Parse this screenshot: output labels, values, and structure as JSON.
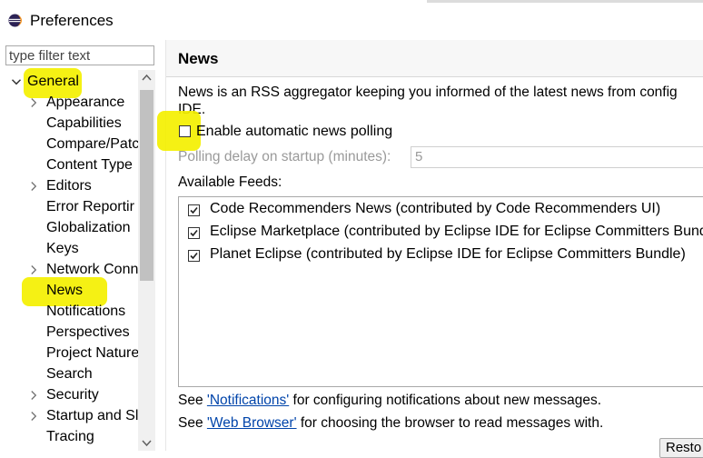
{
  "window": {
    "title": "Preferences",
    "icon": "eclipse-icon"
  },
  "sidebar": {
    "filter_placeholder": "type filter text",
    "tree": [
      {
        "label": "General",
        "expanded": true,
        "level": 0
      },
      {
        "label": "Appearance",
        "expandable": true,
        "level": 1
      },
      {
        "label": "Capabilities",
        "level": 1
      },
      {
        "label": "Compare/Patc",
        "level": 1
      },
      {
        "label": "Content Type",
        "level": 1
      },
      {
        "label": "Editors",
        "expandable": true,
        "level": 1
      },
      {
        "label": "Error Reportir",
        "level": 1
      },
      {
        "label": "Globalization",
        "level": 1
      },
      {
        "label": "Keys",
        "level": 1
      },
      {
        "label": "Network Conn",
        "expandable": true,
        "level": 1
      },
      {
        "label": "News",
        "selected": true,
        "level": 1
      },
      {
        "label": "Notifications",
        "level": 1
      },
      {
        "label": "Perspectives",
        "level": 1
      },
      {
        "label": "Project Nature",
        "level": 1
      },
      {
        "label": "Search",
        "level": 1
      },
      {
        "label": "Security",
        "expandable": true,
        "level": 1
      },
      {
        "label": "Startup and Sl",
        "expandable": true,
        "level": 1
      },
      {
        "label": "Tracing",
        "level": 1
      }
    ]
  },
  "page": {
    "title": "News",
    "description": "News is an RSS aggregator keeping you informed of the latest news from configured feeds in the Eclipse IDE.",
    "description_line1": "News is an RSS aggregator keeping you informed of the latest news from config",
    "description_line2": "IDE.",
    "enable_polling": {
      "label": "Enable automatic news polling",
      "checked": false
    },
    "polling_delay": {
      "label": "Polling delay on startup (minutes):",
      "value": "5",
      "disabled": true
    },
    "feeds_label": "Available Feeds:",
    "feeds": [
      {
        "label": "Code Recommenders News (contributed by Code Recommenders UI)",
        "checked": true
      },
      {
        "label": "Eclipse Marketplace (contributed by Eclipse IDE for Eclipse Committers Bundle)",
        "checked": true
      },
      {
        "label": "Planet Eclipse (contributed by Eclipse IDE for Eclipse Committers Bundle)",
        "checked": true
      }
    ],
    "footer": [
      {
        "prefix": "See ",
        "link": "'Notifications'",
        "suffix": " for configuring notifications about new messages."
      },
      {
        "prefix": "See ",
        "link": "'Web Browser'",
        "suffix": " for choosing the browser to read messages with."
      }
    ],
    "restore_button": "Resto"
  },
  "colors": {
    "highlight": "#f4f000",
    "link": "#0044aa",
    "disabled_text": "#9a9a9a"
  }
}
